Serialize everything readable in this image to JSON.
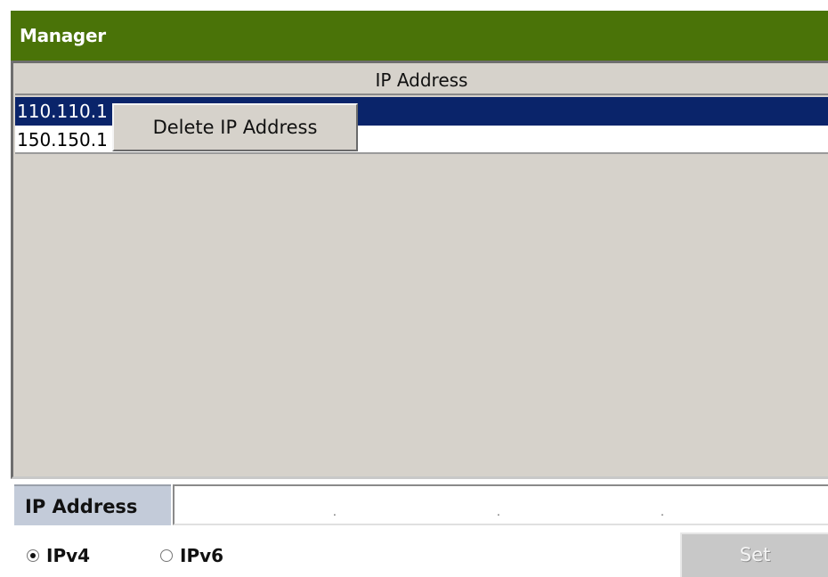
{
  "window": {
    "title": "Manager"
  },
  "table": {
    "header": "IP Address",
    "rows": [
      "110.110.1",
      "150.150.1"
    ],
    "selected_index": 0
  },
  "context_menu": {
    "items": [
      "Delete IP Address"
    ]
  },
  "form": {
    "ip_label": "IP Address",
    "ip_value": "",
    "ip_separators": [
      ".",
      ".",
      "."
    ],
    "radio_options": [
      {
        "label": "IPv4",
        "checked": true
      },
      {
        "label": "IPv6",
        "checked": false
      }
    ],
    "set_label": "Set",
    "set_enabled": false
  },
  "colors": {
    "title_bar": "#4a7308",
    "selection": "#0a246a",
    "panel_bg": "#d6d2cb"
  }
}
